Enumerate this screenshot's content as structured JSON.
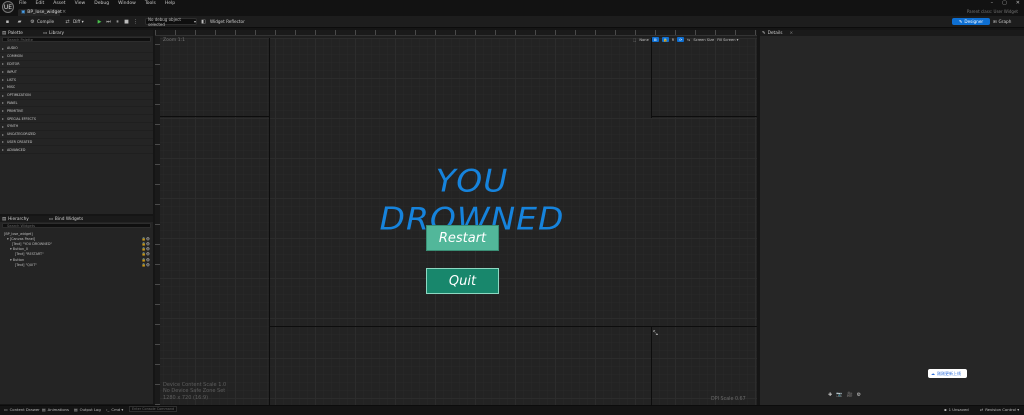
{
  "app": {
    "logo": "UE",
    "menu": [
      "File",
      "Edit",
      "Asset",
      "View",
      "Debug",
      "Window",
      "Tools",
      "Help"
    ],
    "window_controls": [
      "–",
      "▢",
      "✕"
    ]
  },
  "tab": {
    "asset_name": "BP_lose_widget",
    "close": "×",
    "parent_class": "Parent class:  User Widget"
  },
  "toolbar": {
    "compile_label": "Compile",
    "diff_label": "Diff ▾",
    "debug_select": "No debug object selected",
    "reflector_label": "Widget Reflector",
    "designer_label": "Designer",
    "graph_label": "Graph"
  },
  "palette": {
    "title": "Palette",
    "library_tab": "Library",
    "search_placeholder": "Search Palette",
    "categories": [
      "AUDIO",
      "COMMON",
      "EDITOR",
      "INPUT",
      "LISTS",
      "MISC",
      "OPTIMIZATION",
      "PANEL",
      "PRIMITIVE",
      "SPECIAL EFFECTS",
      "SYNTH",
      "UNCATEGORIZED",
      "USER CREATED",
      "ADVANCED"
    ]
  },
  "hierarchy": {
    "title": "Hierarchy",
    "bind_tab": "Bind Widgets",
    "search_placeholder": "Search Widgets",
    "items": [
      {
        "label": "[BP_lose_widget]"
      },
      {
        "label": "▾ [Canvas Panel]"
      },
      {
        "label": "[Text] \"YOU DROWNED\""
      },
      {
        "label": "▾ Button_0"
      },
      {
        "label": "[Text] \"RESTART\""
      },
      {
        "label": "▾ Button"
      },
      {
        "label": "[Text] \"QUIT\""
      }
    ]
  },
  "canvas": {
    "zoom": "Zoom 1:1",
    "tools": [
      "None",
      "R",
      "Screen Size",
      "Fill Screen ▾"
    ],
    "headline": "YOU DROWNED",
    "restart_label": "Restart",
    "quit_label": "Quit",
    "device_info": [
      "Device Content Scale 1.0",
      "No Device Safe Zone Set",
      "1280 x 720 (16:9)"
    ],
    "dpi_scale": "DPI Scale 0.67"
  },
  "details": {
    "title": "Details",
    "tool_icons": [
      "✚",
      "📷",
      "🎥",
      "⚙"
    ],
    "promo_label": "刚刚更新上线"
  },
  "statusbar": {
    "content_drawer": "Content Drawer",
    "animations": "Animations",
    "output_log": "Output Log",
    "cmd_label": "Cmd ▾",
    "cmd_placeholder": "Enter Console Command",
    "unsaved": "1 Unsaved",
    "revision": "Revision Control ▾"
  },
  "colors": {
    "accent_blue": "#0e6fd2",
    "headline_blue": "#1683dc",
    "restart_green": "#52b79a",
    "quit_green": "#18876c"
  }
}
